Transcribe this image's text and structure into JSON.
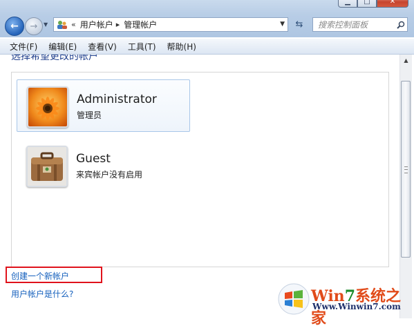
{
  "window": {
    "buttons": [
      "minimize",
      "maximize",
      "close"
    ]
  },
  "address_bar": {
    "overflow": "«",
    "crumbs": [
      "用户帐户",
      "管理帐户"
    ]
  },
  "search": {
    "placeholder": "搜索控制面板"
  },
  "menu": [
    "文件(F)",
    "编辑(E)",
    "查看(V)",
    "工具(T)",
    "帮助(H)"
  ],
  "content": {
    "heading": "选择希望更改的帐户",
    "accounts": [
      {
        "name": "Administrator",
        "type": "管理员",
        "picture": "flower-icon",
        "selected": true
      },
      {
        "name": "Guest",
        "type": "来宾帐户没有启用",
        "picture": "suitcase-icon",
        "selected": false
      }
    ],
    "links": {
      "create": "创建一个新帐户",
      "what": "用户帐户是什么?"
    }
  },
  "watermark": {
    "brand_pre": "Win",
    "brand_7": "7",
    "brand_post": "系统之家",
    "url": "Www.Winwin7.com"
  },
  "colors": {
    "link": "#1560bd",
    "highlight": "#e0121b",
    "selection_border": "#a8c6e8"
  }
}
